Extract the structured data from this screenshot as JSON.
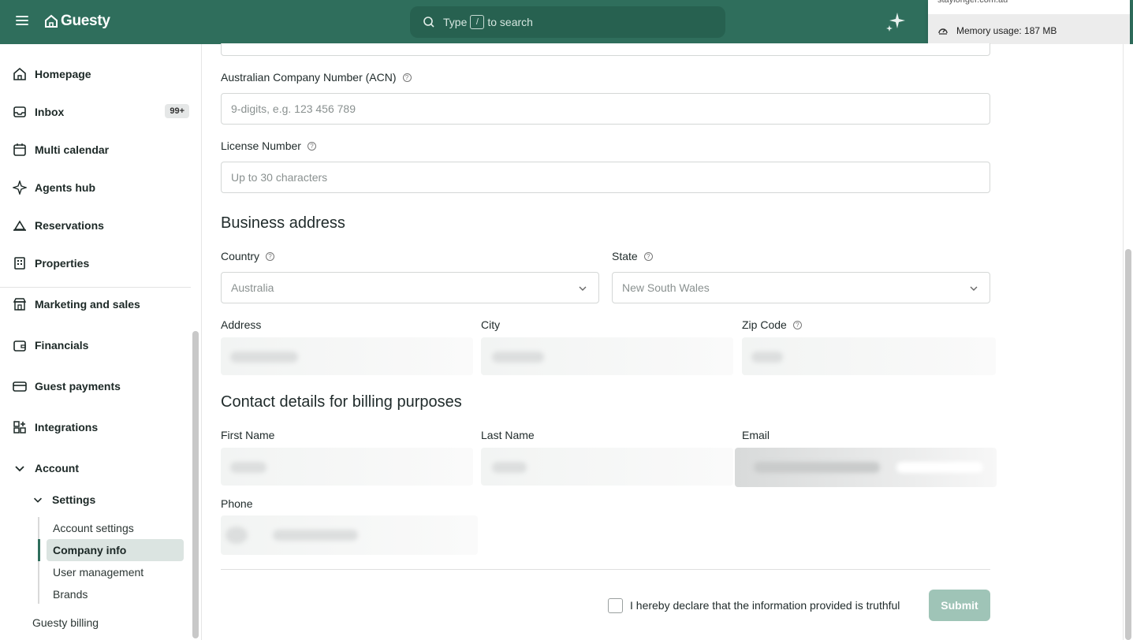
{
  "topbar": {
    "logo_text": "Guesty",
    "search": {
      "prefix": "Type",
      "key": "/",
      "suffix": "to search"
    }
  },
  "memory": {
    "top_text": "staylonger.com.au",
    "usage": "Memory usage: 187 MB"
  },
  "sidebar": {
    "items": [
      {
        "label": "Homepage",
        "icon": "home-icon"
      },
      {
        "label": "Inbox",
        "icon": "inbox-icon",
        "badge": "99+"
      },
      {
        "label": "Multi calendar",
        "icon": "calendar-icon"
      },
      {
        "label": "Agents hub",
        "icon": "sparkle-icon"
      },
      {
        "label": "Reservations",
        "icon": "bell-icon"
      },
      {
        "label": "Properties",
        "icon": "building-icon"
      },
      {
        "label": "Marketing and sales",
        "icon": "store-icon"
      },
      {
        "label": "Financials",
        "icon": "wallet-icon"
      },
      {
        "label": "Guest payments",
        "icon": "card-icon"
      },
      {
        "label": "Integrations",
        "icon": "integrations-icon"
      },
      {
        "label": "Account",
        "icon": "chevron-down-icon"
      }
    ],
    "settings_label": "Settings",
    "settings_items": [
      "Account settings",
      "Company info",
      "User management",
      "Brands"
    ],
    "guesty_billing": "Guesty billing"
  },
  "form": {
    "acn_label": "Australian Company Number (ACN)",
    "acn_placeholder": "9-digits, e.g. 123 456 789",
    "license_label": "License Number",
    "license_placeholder": "Up to 30 characters",
    "business_address_heading": "Business address",
    "country_label": "Country",
    "country_value": "Australia",
    "state_label": "State",
    "state_value": "New South Wales",
    "address_label": "Address",
    "city_label": "City",
    "zip_label": "Zip Code",
    "contact_heading": "Contact details for billing purposes",
    "first_name_label": "First Name",
    "last_name_label": "Last Name",
    "email_label": "Email",
    "phone_label": "Phone",
    "declaration": "I hereby declare that the information provided is truthful",
    "submit_label": "Submit"
  },
  "colors": {
    "brand": "#2f6e5c",
    "submit_disabled": "#9fc4b7"
  }
}
